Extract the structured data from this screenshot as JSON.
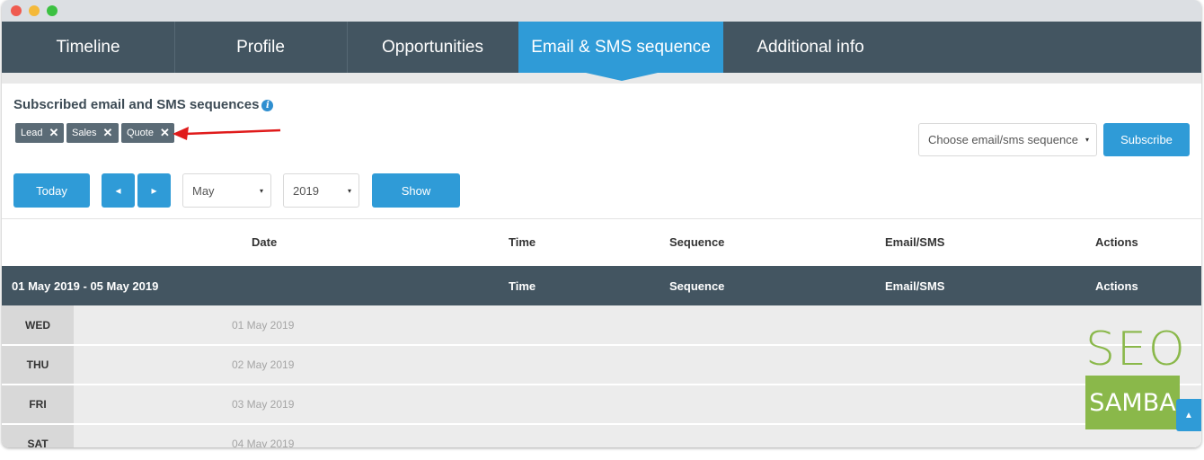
{
  "tabs": [
    {
      "label": "Timeline"
    },
    {
      "label": "Profile"
    },
    {
      "label": "Opportunities"
    },
    {
      "label": "Email & SMS sequence"
    },
    {
      "label": "Additional info"
    }
  ],
  "section": {
    "title": "Subscribed email and SMS sequences",
    "info_icon": "i"
  },
  "tags": [
    {
      "label": "Lead"
    },
    {
      "label": "Sales"
    },
    {
      "label": "Quote"
    }
  ],
  "tag_remove_glyph": "✕",
  "subscribe": {
    "select_value": "Choose email/sms sequence",
    "button_label": "Subscribe"
  },
  "controls": {
    "today_label": "Today",
    "prev_glyph": "◂",
    "next_glyph": "▸",
    "month_value": "May",
    "year_value": "2019",
    "show_label": "Show",
    "caret_glyph": "▾"
  },
  "table": {
    "headers": [
      "Date",
      "Time",
      "Sequence",
      "Email/SMS",
      "Actions"
    ],
    "week": {
      "range": "01 May 2019 - 05 May 2019",
      "headers": [
        "Time",
        "Sequence",
        "Email/SMS",
        "Actions"
      ]
    },
    "days": [
      {
        "day": "WED",
        "date": "01 May 2019"
      },
      {
        "day": "THU",
        "date": "02 May 2019"
      },
      {
        "day": "FRI",
        "date": "03 May 2019"
      },
      {
        "day": "SAT",
        "date": "04 May 2019"
      }
    ]
  },
  "watermark": {
    "top": "SEO",
    "bottom": "SAMBA"
  },
  "scroll_top_glyph": "▲",
  "colors": {
    "accent": "#2f9bd7",
    "header_dark": "#435561",
    "tag": "#5b6b76",
    "annotation_arrow": "#e01b1b",
    "seo_green": "#8ab84a"
  }
}
